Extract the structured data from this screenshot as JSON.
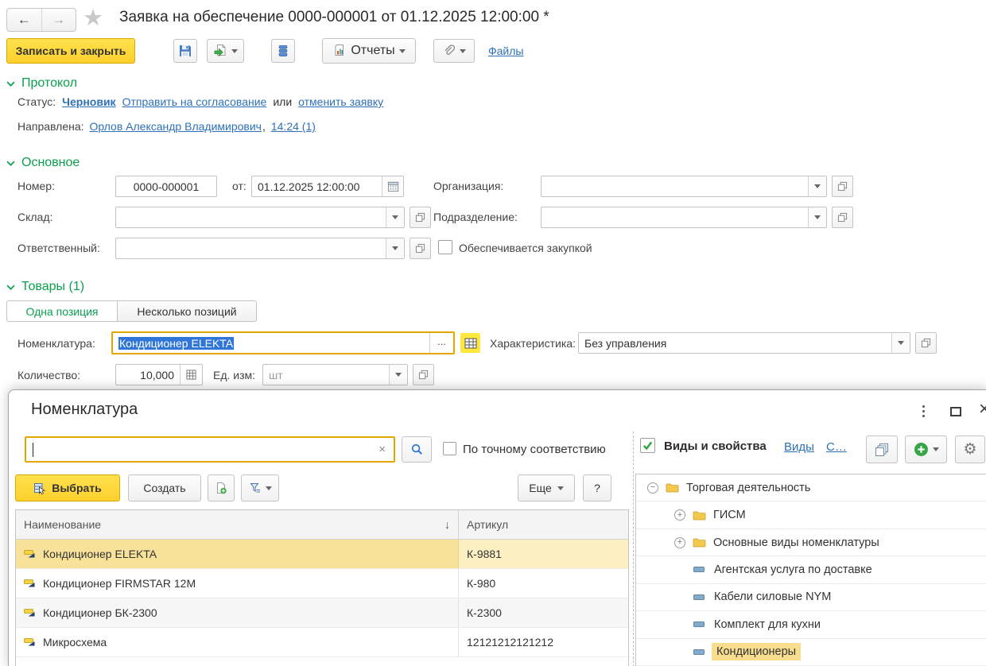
{
  "colors": {
    "accent_yellow": "#ffd02d",
    "section_green": "#0aa14e",
    "link_blue": "#2e71b8",
    "selection_blue": "#2f76d8",
    "row_highlight": "#f8e29a",
    "focus_border": "#e2a600"
  },
  "icons": {
    "back": "←",
    "forward": "→",
    "star": "★",
    "sort_desc": "↓",
    "close": "×",
    "clear": "×",
    "question": "?",
    "ellipsis": "...",
    "collapse": "−",
    "expand": "+",
    "gear": "⚙"
  },
  "header": {
    "title": "Заявка на обеспечение 0000-000001 от 01.12.2025 12:00:00 *"
  },
  "toolbar": {
    "save_close_label": "Записать и закрыть",
    "reports_label": "Отчеты",
    "files_link": "Файлы"
  },
  "protocol": {
    "section_title": "Протокол",
    "status_label": "Статус:",
    "status_value": "Черновик",
    "send_link": "Отправить на согласование",
    "or_text": "или",
    "cancel_link": "отменить заявку",
    "directed_label": "Направлена:",
    "directed_person": "Орлов Александр Владимирович",
    "comma": ",",
    "directed_time": "14:24 (1)"
  },
  "main_section": {
    "section_title": "Основное",
    "number_label": "Номер:",
    "number_value": "0000-000001",
    "from_label": "от:",
    "date_value": "01.12.2025 12:00:00",
    "org_label": "Организация:",
    "warehouse_label": "Склад:",
    "department_label": "Подразделение:",
    "responsible_label": "Ответственный:",
    "purchase_checkbox_label": "Обеспечивается закупкой"
  },
  "goods": {
    "section_title": "Товары (1)",
    "tab_single": "Одна позиция",
    "tab_multiple": "Несколько позиций",
    "nomenclature_label": "Номенклатура:",
    "nomenclature_value": "Кондиционер ELEKTA",
    "characteristic_label": "Характеристика:",
    "characteristic_value": "Без управления",
    "quantity_label": "Количество:",
    "quantity_value": "10,000",
    "unit_label": "Ед. изм:",
    "unit_placeholder": "шт"
  },
  "dialog": {
    "title": "Номенклатура",
    "search": {
      "exact_match_label": "По точному соответствию"
    },
    "buttons": {
      "select": "Выбрать",
      "create": "Создать",
      "more": "Еще"
    },
    "table": {
      "col_name": "Наименование",
      "col_article": "Артикул",
      "rows": [
        {
          "name": "Кондиционер ELEKTA",
          "article": "К-9881"
        },
        {
          "name": "Кондиционер FIRMSTAR 12М",
          "article": "К-980"
        },
        {
          "name": "Кондиционер БК-2300",
          "article": "К-2300"
        },
        {
          "name": "Микросхема",
          "article": "12121212121212"
        }
      ]
    },
    "types_panel": {
      "title": "Виды и свойства",
      "link_types": "Виды",
      "link_props": "С…",
      "tree": [
        {
          "label": "Торговая деятельность"
        },
        {
          "label": "ГИСМ"
        },
        {
          "label": "Основные виды номенклатуры"
        },
        {
          "label": "Агентская услуга по доставке"
        },
        {
          "label": "Кабели силовые NYM"
        },
        {
          "label": "Комплект для кухни"
        },
        {
          "label": "Кондиционеры"
        }
      ]
    }
  }
}
